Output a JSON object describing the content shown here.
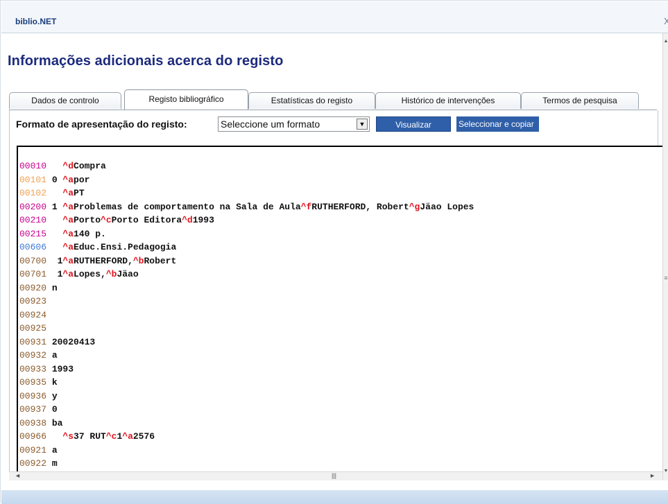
{
  "window": {
    "app_title": "biblio.NET",
    "close_label": "X"
  },
  "page": {
    "title": "Informações adicionais acerca do registo"
  },
  "tabs": [
    {
      "label": "Dados de controlo",
      "active": false
    },
    {
      "label": "Registo bibliográfico",
      "active": true
    },
    {
      "label": "Estatísticas do registo",
      "active": false
    },
    {
      "label": "Histórico de intervenções",
      "active": false
    },
    {
      "label": "Termos de pesquisa",
      "active": false
    }
  ],
  "format": {
    "label": "Formato de apresentação do registo:",
    "selected": "Seleccione um formato",
    "dropdown_icon": "chevron-down-icon"
  },
  "buttons": {
    "visualizar": "Visualizar",
    "seleccionar": "Seleccionar e copiar"
  },
  "colors": {
    "accent_blue": "#2f5fa8",
    "title_navy": "#1c2a7c",
    "subfield_red": "#e0141e",
    "tag_magenta": "#c8008c",
    "tag_orange": "#f0a050",
    "tag_blue": "#3c78d8",
    "tag_brown": "#8b5a2b"
  },
  "record": {
    "lines": [
      {
        "tag": "00010",
        "tag_color": "#c8008c",
        "parts": [
          {
            "t": "   "
          },
          {
            "t": "^d",
            "s": 1
          },
          {
            "t": "Compra"
          }
        ]
      },
      {
        "tag": "00101",
        "tag_color": "#f0a050",
        "parts": [
          {
            "t": " 0 "
          },
          {
            "t": "^a",
            "s": 1
          },
          {
            "t": "por"
          }
        ]
      },
      {
        "tag": "00102",
        "tag_color": "#f0a050",
        "parts": [
          {
            "t": "   "
          },
          {
            "t": "^a",
            "s": 1
          },
          {
            "t": "PT"
          }
        ]
      },
      {
        "tag": "00200",
        "tag_color": "#c8008c",
        "parts": [
          {
            "t": " 1 "
          },
          {
            "t": "^a",
            "s": 1
          },
          {
            "t": "Problemas de comportamento na Sala de Aula"
          },
          {
            "t": "^f",
            "s": 1
          },
          {
            "t": "RUTHERFORD, Robert"
          },
          {
            "t": "^g",
            "s": 1
          },
          {
            "t": "Jäao Lopes"
          }
        ]
      },
      {
        "tag": "00210",
        "tag_color": "#c8008c",
        "parts": [
          {
            "t": "   "
          },
          {
            "t": "^a",
            "s": 1
          },
          {
            "t": "Porto"
          },
          {
            "t": "^c",
            "s": 1
          },
          {
            "t": "Porto Editora"
          },
          {
            "t": "^d",
            "s": 1
          },
          {
            "t": "1993"
          }
        ]
      },
      {
        "tag": "00215",
        "tag_color": "#c8008c",
        "parts": [
          {
            "t": "   "
          },
          {
            "t": "^a",
            "s": 1
          },
          {
            "t": "140 p."
          }
        ]
      },
      {
        "tag": "00606",
        "tag_color": "#3c78d8",
        "parts": [
          {
            "t": "   "
          },
          {
            "t": "^a",
            "s": 1
          },
          {
            "t": "Educ.Ensi.Pedagogia"
          }
        ]
      },
      {
        "tag": "00700",
        "tag_color": "#8b5a2b",
        "parts": [
          {
            "t": "  1"
          },
          {
            "t": "^a",
            "s": 1
          },
          {
            "t": "RUTHERFORD,"
          },
          {
            "t": "^b",
            "s": 1
          },
          {
            "t": "Robert"
          }
        ]
      },
      {
        "tag": "00701",
        "tag_color": "#8b5a2b",
        "parts": [
          {
            "t": "  1"
          },
          {
            "t": "^a",
            "s": 1
          },
          {
            "t": "Lopes,"
          },
          {
            "t": "^b",
            "s": 1
          },
          {
            "t": "Jäao"
          }
        ]
      },
      {
        "tag": "00920",
        "tag_color": "#8b5a2b",
        "parts": [
          {
            "t": " n"
          }
        ]
      },
      {
        "tag": "00923",
        "tag_color": "#8b5a2b",
        "parts": []
      },
      {
        "tag": "00924",
        "tag_color": "#8b5a2b",
        "parts": []
      },
      {
        "tag": "00925",
        "tag_color": "#8b5a2b",
        "parts": []
      },
      {
        "tag": "00931",
        "tag_color": "#8b5a2b",
        "parts": [
          {
            "t": " 20020413"
          }
        ]
      },
      {
        "tag": "00932",
        "tag_color": "#8b5a2b",
        "parts": [
          {
            "t": " a"
          }
        ]
      },
      {
        "tag": "00933",
        "tag_color": "#8b5a2b",
        "parts": [
          {
            "t": " 1993"
          }
        ]
      },
      {
        "tag": "00935",
        "tag_color": "#8b5a2b",
        "parts": [
          {
            "t": " k"
          }
        ]
      },
      {
        "tag": "00936",
        "tag_color": "#8b5a2b",
        "parts": [
          {
            "t": " y"
          }
        ]
      },
      {
        "tag": "00937",
        "tag_color": "#8b5a2b",
        "parts": [
          {
            "t": " 0"
          }
        ]
      },
      {
        "tag": "00938",
        "tag_color": "#8b5a2b",
        "parts": [
          {
            "t": " ba"
          }
        ]
      },
      {
        "tag": "00966",
        "tag_color": "#8b5a2b",
        "parts": [
          {
            "t": "   "
          },
          {
            "t": "^s",
            "s": 1
          },
          {
            "t": "37 RUT"
          },
          {
            "t": "^c",
            "s": 1
          },
          {
            "t": "1"
          },
          {
            "t": "^a",
            "s": 1
          },
          {
            "t": "2576"
          }
        ]
      },
      {
        "tag": "00921",
        "tag_color": "#8b5a2b",
        "parts": [
          {
            "t": " a"
          }
        ]
      },
      {
        "tag": "00922",
        "tag_color": "#8b5a2b",
        "parts": [
          {
            "t": " m"
          }
        ]
      }
    ]
  },
  "scrollbars": {
    "up_icon": "arrow-up-icon",
    "down_icon": "arrow-down-icon",
    "left_icon": "arrow-left-icon",
    "right_icon": "arrow-right-icon",
    "grip_icon": "grip-icon"
  }
}
